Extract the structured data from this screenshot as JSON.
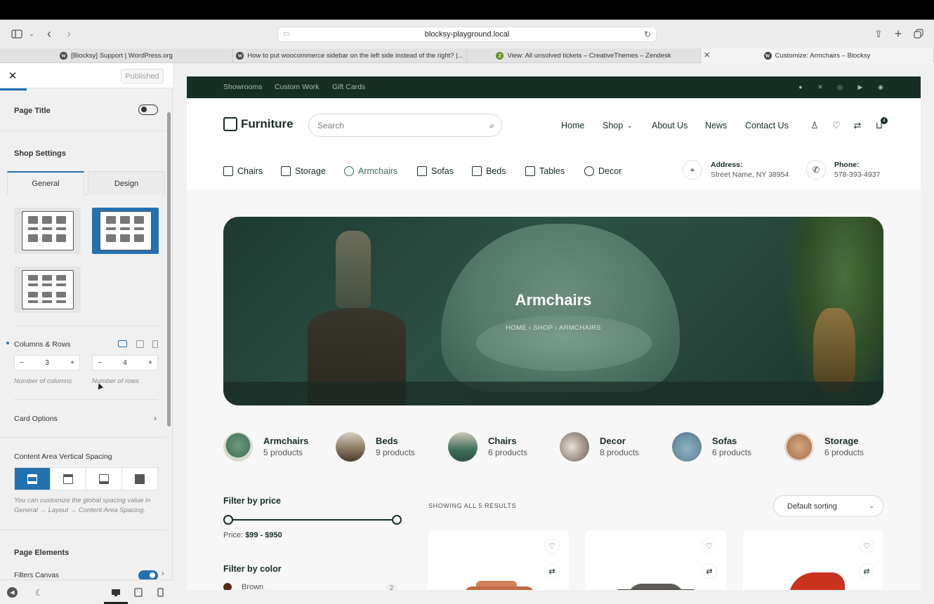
{
  "browser": {
    "url": "blocksy-playground.local",
    "tabs": [
      {
        "label": "[Blocksy] Support | WordPress.org",
        "active": false
      },
      {
        "label": "How to put woocommerce sidebar on the left side instead of the right? |...",
        "active": false
      },
      {
        "label": "View: All unsolved tickets – CreativeThemes – Zendesk",
        "active": false
      },
      {
        "label": "Customize: Armchairs – Blocksy",
        "active": true
      }
    ]
  },
  "customizer": {
    "published_label": "Published",
    "page_title_label": "Page Title",
    "shop_settings_label": "Shop Settings",
    "tab_general": "General",
    "tab_design": "Design",
    "columns_rows_label": "Columns & Rows",
    "columns_value": "3",
    "rows_value": "4",
    "columns_help": "Number of columns",
    "rows_help": "Number of rows",
    "card_options_label": "Card Options",
    "spacing_label": "Content Area Vertical Spacing",
    "spacing_help": "You can customize the global spacing value in General → Layout → Content Area Spacing.",
    "page_elements_label": "Page Elements",
    "filters_canvas_label": "Filters Canvas",
    "minus": "−",
    "plus": "+"
  },
  "site": {
    "top_links": [
      "Showrooms",
      "Custom Work",
      "Gift Cards"
    ],
    "logo_text": "Furniture",
    "search_placeholder": "Search",
    "nav": [
      "Home",
      "Shop",
      "About Us",
      "News",
      "Contact Us"
    ],
    "cart_count": "4",
    "categories_nav": [
      "Chairs",
      "Storage",
      "Armchairs",
      "Sofas",
      "Beds",
      "Tables",
      "Decor"
    ],
    "address_label": "Address:",
    "address_value": "Street Name, NY 38954",
    "phone_label": "Phone:",
    "phone_value": "578-393-4937",
    "hero_title": "Armchairs",
    "breadcrumb": "HOME  ›  SHOP  ›  ARMCHAIRS",
    "category_cards": [
      {
        "name": "Armchairs",
        "count": "5 products",
        "color": "#4f7a63"
      },
      {
        "name": "Beds",
        "count": "9 products",
        "color": "#8a7a64"
      },
      {
        "name": "Chairs",
        "count": "6 products",
        "color": "#3f6e5a"
      },
      {
        "name": "Decor",
        "count": "8 products",
        "color": "#9c9088"
      },
      {
        "name": "Sofas",
        "count": "6 products",
        "color": "#6f93a6"
      },
      {
        "name": "Storage",
        "count": "6 products",
        "color": "#b3805a"
      }
    ],
    "filter_price_label": "Filter by price",
    "price_text_label": "Price:",
    "price_range": "$99 - $950",
    "results_text": "SHOWING ALL 5 RESULTS",
    "sort_label": "Default sorting",
    "filter_color_label": "Filter by color",
    "color_brown": "Brown",
    "color_brown_count": "2"
  },
  "colors": {
    "accent": "#2271b1",
    "site_dark": "#172e25"
  }
}
